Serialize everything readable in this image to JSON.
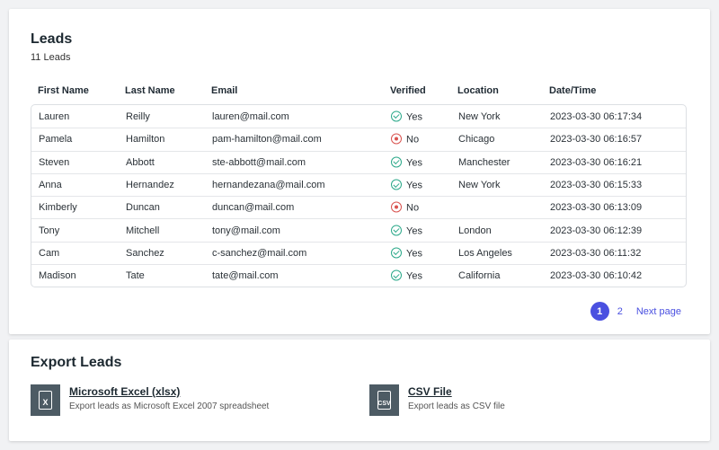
{
  "leads": {
    "title": "Leads",
    "count": "11 Leads",
    "columns": [
      "First Name",
      "Last Name",
      "Email",
      "Verified",
      "Location",
      "Date/Time"
    ],
    "rows": [
      [
        "Lauren",
        "Reilly",
        "lauren@mail.com",
        "Yes",
        "New York",
        "2023-03-30 06:17:34"
      ],
      [
        "Pamela",
        "Hamilton",
        "pam-hamilton@mail.com",
        "No",
        "Chicago",
        "2023-03-30 06:16:57"
      ],
      [
        "Steven",
        "Abbott",
        "ste-abbott@mail.com",
        "Yes",
        "Manchester",
        "2023-03-30 06:16:21"
      ],
      [
        "Anna",
        "Hernandez",
        "hernandezana@mail.com",
        "Yes",
        "New York",
        "2023-03-30 06:15:33"
      ],
      [
        "Kimberly",
        "Duncan",
        "duncan@mail.com",
        "No",
        "",
        "2023-03-30 06:13:09"
      ],
      [
        "Tony",
        "Mitchell",
        "tony@mail.com",
        "Yes",
        "London",
        "2023-03-30 06:12:39"
      ],
      [
        "Cam",
        "Sanchez",
        "c-sanchez@mail.com",
        "Yes",
        "Los Angeles",
        "2023-03-30 06:11:32"
      ],
      [
        "Madison",
        "Tate",
        "tate@mail.com",
        "Yes",
        "California",
        "2023-03-30 06:10:42"
      ]
    ],
    "pagination": {
      "pages": [
        "1",
        "2"
      ],
      "next": "Next page"
    }
  },
  "export": {
    "title": "Export Leads",
    "options": [
      {
        "label": "Microsoft Excel (xlsx)",
        "desc": "Export leads as Microsoft Excel 2007 spreadsheet",
        "icon_text": "X"
      },
      {
        "label": "CSV File",
        "desc": "Export leads as CSV file",
        "icon_text": "CSV"
      }
    ]
  },
  "colors": {
    "accent": "#4a50e0",
    "yes": "#2aa889",
    "no": "#d9534f"
  }
}
